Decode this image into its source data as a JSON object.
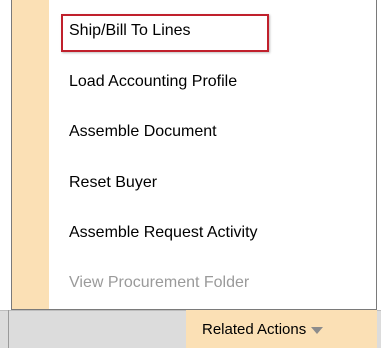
{
  "menu": {
    "items": [
      {
        "label": "Ship/Bill To Lines",
        "enabled": true,
        "highlighted": true
      },
      {
        "label": "Load Accounting Profile",
        "enabled": true
      },
      {
        "label": "Assemble Document",
        "enabled": true
      },
      {
        "label": "Reset Buyer",
        "enabled": true
      },
      {
        "label": "Assemble Request Activity",
        "enabled": true
      },
      {
        "label": "View Procurement Folder",
        "enabled": false
      }
    ],
    "gutter_color": "#fbe0b5",
    "highlight_color": "#c0202c"
  },
  "footer": {
    "related_actions_label": "Related Actions",
    "related_actions_icon": "chevron-down-icon"
  }
}
